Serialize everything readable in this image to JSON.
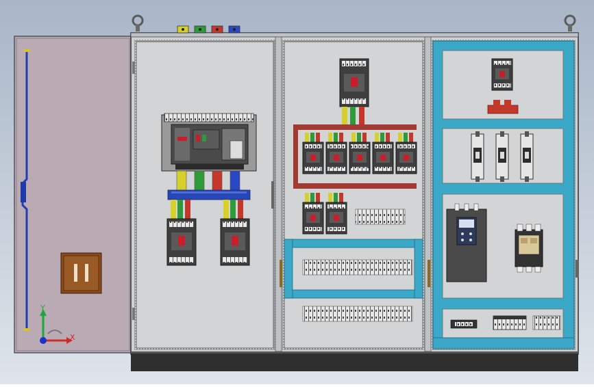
{
  "viewport": {
    "background_top": "#a9b6c8",
    "background_bottom": "#dfe4ea"
  },
  "colors": {
    "cabinet": "#d4d6d8",
    "cabinet_edge": "#3a3a3a",
    "base": "#2f2f2f",
    "door": "#b9aab4",
    "busbar_red": "#a23a34",
    "busbar_blue": "#2747b5",
    "rail_cyan": "#3ba8c8",
    "phase_yellow": "#d8d02a",
    "phase_green": "#2f9a3a",
    "phase_red": "#c4382c",
    "phase_blue": "#2b48c4",
    "breaker_dark": "#3e3e3e",
    "breaker_red": "#c81e2a",
    "handle_brown": "#8a4a1c"
  },
  "top_terminals": [
    "phase_yellow",
    "phase_green",
    "phase_red",
    "phase_blue"
  ],
  "triad": {
    "x_label": "X",
    "y_label": "Y"
  },
  "icons": [
    "lifting-eye-icon",
    "door-handle-icon",
    "axis-triad-icon",
    "hinge-icon"
  ]
}
